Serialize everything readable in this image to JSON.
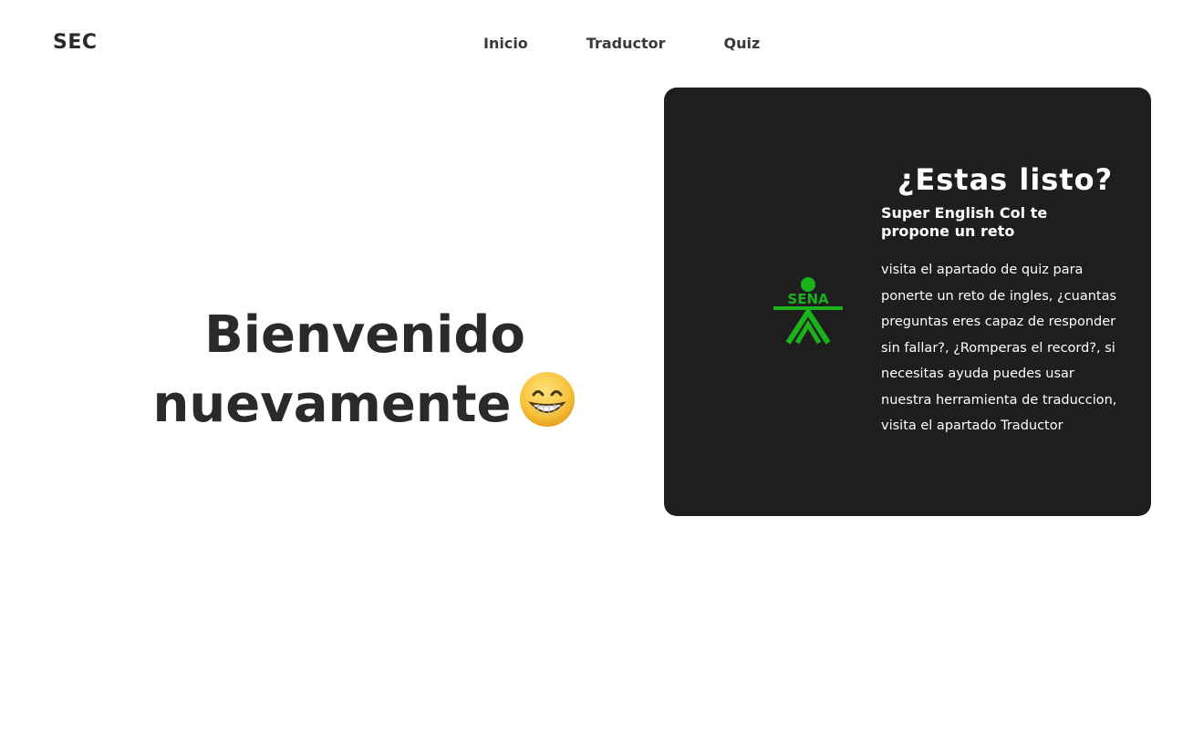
{
  "header": {
    "brand": "SEC",
    "nav": [
      {
        "label": "Inicio"
      },
      {
        "label": "Traductor"
      },
      {
        "label": "Quiz"
      }
    ]
  },
  "hero": {
    "line1": "Bienvenido",
    "line2": "nuevamente",
    "emoji_icon": "grinning-face-icon"
  },
  "card": {
    "title": "¿Estas listo?",
    "subtitle": "Super English Col te propone un reto",
    "body": "visita el apartado de quiz para ponerte un reto de ingles, ¿cuantas preguntas eres capaz de responder sin fallar?, ¿Romperas el record?, si necesitas ayuda puedes usar nuestra herramienta de traduccion, visita el apartado Traductor",
    "logo_text": "SENA",
    "logo_color": "#1ab21a",
    "background": "#1e1e1e"
  }
}
